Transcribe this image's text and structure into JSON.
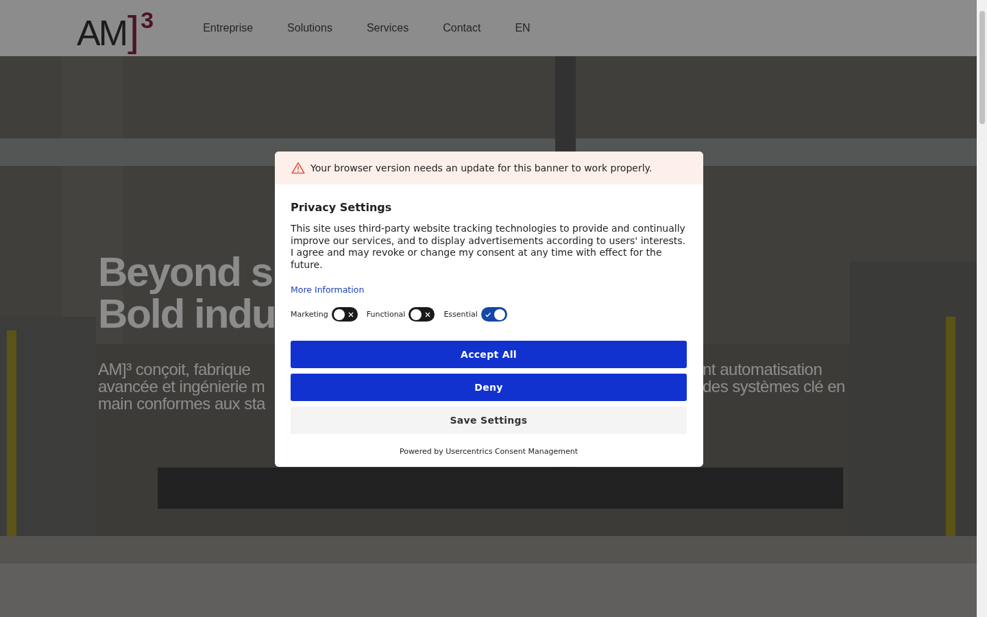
{
  "header": {
    "logo": {
      "text": "AM",
      "bracket": "]",
      "exponent": "3"
    },
    "nav": [
      {
        "label": "Entreprise"
      },
      {
        "label": "Solutions"
      },
      {
        "label": "Services"
      },
      {
        "label": "Contact"
      },
      {
        "label": "EN"
      }
    ]
  },
  "hero": {
    "title_lines": [
      "Beyond s",
      "Bold indu"
    ],
    "subtitle_lines": [
      {
        "left": "AM]³ conçoit, fabrique",
        "right": "nt automatisation"
      },
      {
        "left": "avancée et ingénierie m",
        "right": "des systèmes clé en"
      },
      {
        "left": "main conformes aux sta"
      }
    ]
  },
  "consent": {
    "warning": "Your browser version needs an update for this banner to work properly.",
    "title": "Privacy Settings",
    "body": "This site uses third-party website tracking technologies to provide and continually improve our services, and to display advertisements according to users' interests. I agree and may revoke or change my consent at any time with effect for the future.",
    "link": "More Information",
    "toggles": [
      {
        "label": "Marketing",
        "on": false
      },
      {
        "label": "Functional",
        "on": false
      },
      {
        "label": "Essential",
        "on": true
      }
    ],
    "buttons": [
      {
        "label": "Accept All",
        "kind": "primary"
      },
      {
        "label": "Deny",
        "kind": "primary"
      },
      {
        "label": "Save Settings",
        "kind": "secondary"
      }
    ],
    "footer": "Powered by Usercentrics Consent Management"
  }
}
